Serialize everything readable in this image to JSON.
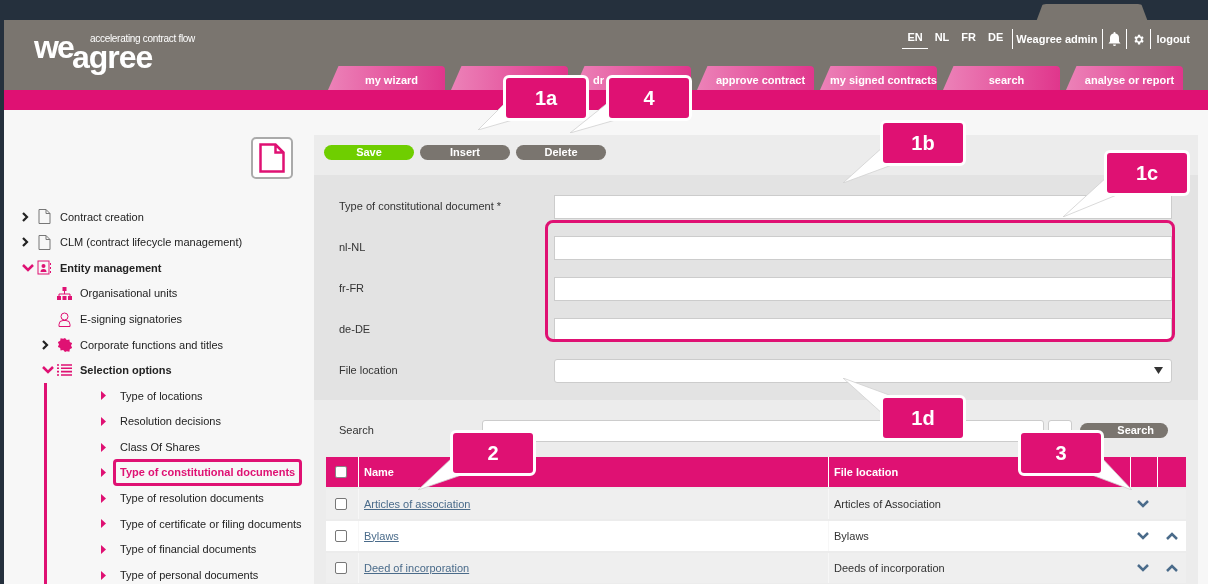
{
  "logo": {
    "word_top": "we",
    "word_bottom": "agree",
    "tagline": "accelerating contract flow"
  },
  "languages": [
    {
      "label": "EN",
      "selected": true
    },
    {
      "label": "NL",
      "selected": false
    },
    {
      "label": "FR",
      "selected": false
    },
    {
      "label": "DE",
      "selected": false
    }
  ],
  "user": "Weagree admin",
  "logout": "logout",
  "tabs": [
    {
      "kind": "full",
      "label": "my wizard"
    },
    {
      "kind": "blank"
    },
    {
      "kind": "cut",
      "label": "dr"
    },
    {
      "kind": "full",
      "label": "approve contract"
    },
    {
      "kind": "full",
      "label": "my signed contracts"
    },
    {
      "kind": "full",
      "label": "search"
    },
    {
      "kind": "full",
      "label": "analyse or report"
    }
  ],
  "sidebar": {
    "items": [
      {
        "label": "Contract creation",
        "kind": "document",
        "expanded": false
      },
      {
        "label": "CLM (contract lifecycle management)",
        "kind": "document",
        "expanded": false
      },
      {
        "label": "Entity management",
        "kind": "entity",
        "expanded": true,
        "children": [
          {
            "label": "Organisational units",
            "kind": "org"
          },
          {
            "label": "E-signing signatories",
            "kind": "person"
          },
          {
            "label": "Corporate functions and titles",
            "kind": "badge",
            "expanded": false
          },
          {
            "label": "Selection options",
            "kind": "list",
            "expanded": true,
            "children": [
              {
                "label": "Type of locations",
                "kind": "option",
                "selected": false
              },
              {
                "label": "Resolution decisions",
                "kind": "option",
                "selected": false
              },
              {
                "label": "Class Of Shares",
                "kind": "option",
                "selected": false
              },
              {
                "label": "Type of constitutional documents",
                "kind": "option",
                "selected": true
              },
              {
                "label": "Type of resolution documents",
                "kind": "option",
                "selected": false
              },
              {
                "label": "Type of certificate or filing documents",
                "kind": "option",
                "selected": false
              },
              {
                "label": "Type of financial documents",
                "kind": "option",
                "selected": false
              },
              {
                "label": "Type of personal documents",
                "kind": "option",
                "selected": false
              }
            ]
          }
        ]
      }
    ]
  },
  "toolbar": [
    {
      "label": "Save",
      "kind": "primary"
    },
    {
      "label": "Insert",
      "kind": "secondary"
    },
    {
      "label": "Delete",
      "kind": "secondary"
    }
  ],
  "form": {
    "fields": [
      {
        "label": "Type of constitutional document *",
        "kind": "text"
      },
      {
        "label": "nl-NL",
        "kind": "text"
      },
      {
        "label": "fr-FR",
        "kind": "text"
      },
      {
        "label": "de-DE",
        "kind": "text"
      },
      {
        "label": "File location",
        "kind": "select"
      }
    ]
  },
  "search": {
    "label": "Search",
    "button": "Search"
  },
  "table": {
    "select_all_checked": false,
    "columns": [
      "Name",
      "File location"
    ],
    "rows": [
      {
        "name": "Articles of association",
        "file_location": "Articles of Association",
        "checked": false,
        "move_down": true,
        "move_up": false
      },
      {
        "name": "Bylaws",
        "file_location": "Bylaws",
        "checked": false,
        "move_down": true,
        "move_up": true
      },
      {
        "name": "Deed of incorporation",
        "file_location": "Deeds of incorporation",
        "checked": false,
        "move_down": true,
        "move_up": true
      }
    ]
  },
  "callouts": [
    {
      "label": "1a"
    },
    {
      "label": "4"
    },
    {
      "label": "1b"
    },
    {
      "label": "1c"
    },
    {
      "label": "1d"
    },
    {
      "label": "2"
    },
    {
      "label": "3"
    }
  ]
}
